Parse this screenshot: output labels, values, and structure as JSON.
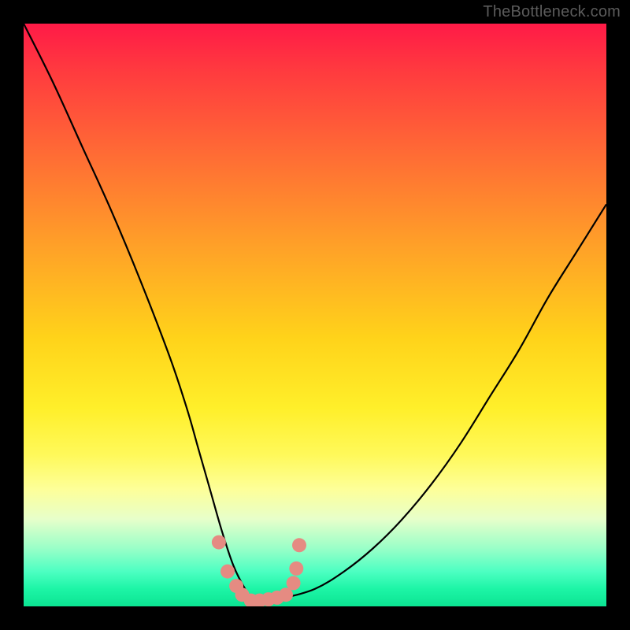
{
  "watermark": "TheBottleneck.com",
  "chart_data": {
    "type": "line",
    "title": "",
    "xlabel": "",
    "ylabel": "",
    "xlim": [
      0,
      100
    ],
    "ylim": [
      0,
      100
    ],
    "series": [
      {
        "name": "bottleneck-curve",
        "x": [
          0,
          5,
          10,
          15,
          20,
          25,
          28,
          30,
          32,
          34,
          36,
          38,
          39.5,
          41,
          43,
          45,
          50,
          55,
          60,
          65,
          70,
          75,
          80,
          85,
          90,
          95,
          100
        ],
        "values": [
          100,
          90,
          79,
          68,
          56,
          43,
          34,
          27,
          20,
          13,
          7,
          3,
          1,
          1,
          1,
          1.5,
          3,
          6,
          10,
          15,
          21,
          28,
          36,
          44,
          53,
          61,
          69
        ]
      },
      {
        "name": "dot-markers",
        "x": [
          33.5,
          35.0,
          36.5,
          37.5,
          39.0,
          40.5,
          42.0,
          43.5,
          45.0,
          46.3,
          46.8,
          47.3
        ],
        "values": [
          11.0,
          6.0,
          3.5,
          2.0,
          1.0,
          1.0,
          1.2,
          1.5,
          2.0,
          4.0,
          6.5,
          10.5
        ]
      }
    ],
    "gradient_stops": [
      {
        "pos": 0,
        "color": "#ff1a47"
      },
      {
        "pos": 22,
        "color": "#ff6a35"
      },
      {
        "pos": 54,
        "color": "#ffd31a"
      },
      {
        "pos": 80,
        "color": "#fdff9a"
      },
      {
        "pos": 94,
        "color": "#4dffc2"
      },
      {
        "pos": 100,
        "color": "#0be492"
      }
    ]
  }
}
